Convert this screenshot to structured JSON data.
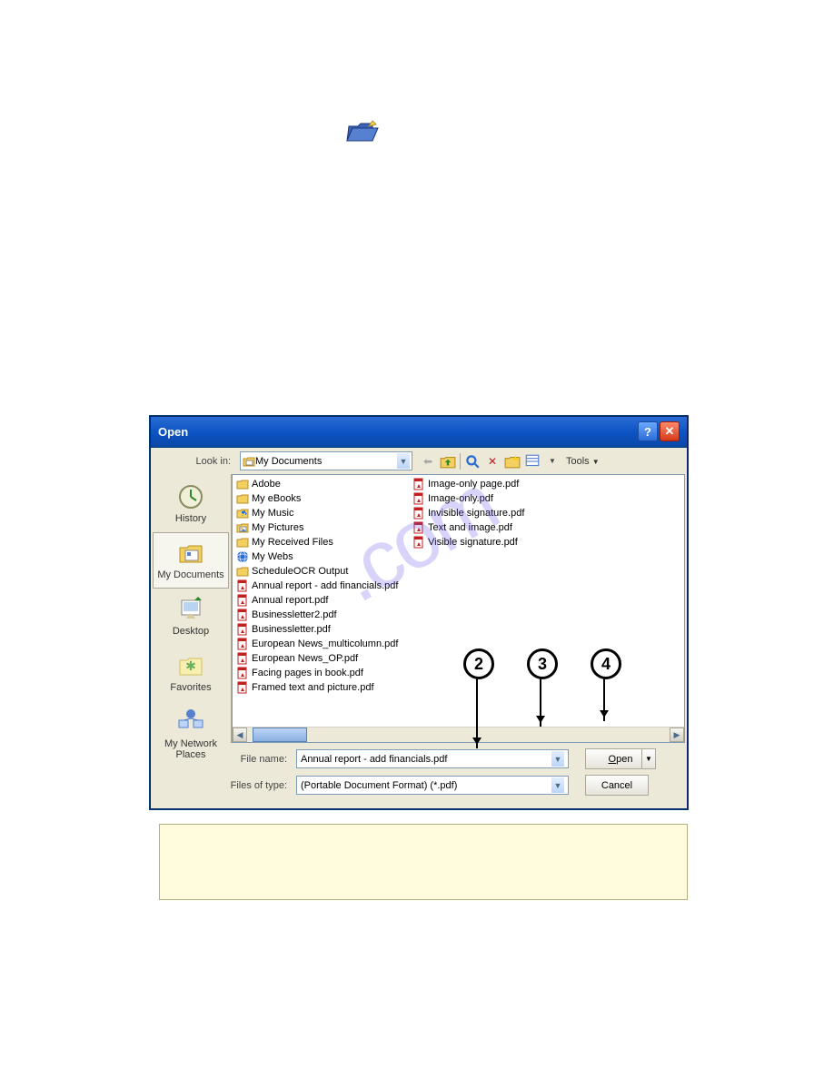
{
  "watermark_text": ".com",
  "dialog": {
    "title": "Open",
    "lookin_label": "Look in:",
    "lookin_value": "My Documents",
    "tools_label": "Tools",
    "places": [
      {
        "icon": "history",
        "label": "History"
      },
      {
        "icon": "mydocs",
        "label": "My Documents",
        "selected": true
      },
      {
        "icon": "desktop",
        "label": "Desktop"
      },
      {
        "icon": "favorites",
        "label": "Favorites"
      },
      {
        "icon": "network",
        "label": "My Network Places",
        "two_line": true
      }
    ],
    "files_col1": [
      {
        "icon": "folder",
        "name": "Adobe"
      },
      {
        "icon": "folder",
        "name": "My eBooks"
      },
      {
        "icon": "music",
        "name": "My Music"
      },
      {
        "icon": "pictures",
        "name": "My Pictures"
      },
      {
        "icon": "folder",
        "name": "My Received Files"
      },
      {
        "icon": "web",
        "name": "My Webs"
      },
      {
        "icon": "folder",
        "name": "ScheduleOCR Output"
      },
      {
        "icon": "pdf",
        "name": "Annual report - add financials.pdf"
      },
      {
        "icon": "pdf",
        "name": "Annual report.pdf"
      },
      {
        "icon": "pdf",
        "name": "Businessletter2.pdf"
      },
      {
        "icon": "pdf",
        "name": "Businessletter.pdf"
      },
      {
        "icon": "pdf",
        "name": "European News_multicolumn.pdf"
      },
      {
        "icon": "pdf",
        "name": "European News_OP.pdf"
      },
      {
        "icon": "pdf",
        "name": "Facing pages in book.pdf"
      },
      {
        "icon": "pdf",
        "name": "Framed text and picture.pdf"
      }
    ],
    "files_col2": [
      {
        "icon": "pdf",
        "name": "Image-only page.pdf"
      },
      {
        "icon": "pdf",
        "name": "Image-only.pdf"
      },
      {
        "icon": "pdf",
        "name": "Invisible signature.pdf"
      },
      {
        "icon": "pdf",
        "name": "Text and image.pdf"
      },
      {
        "icon": "pdf",
        "name": "Visible signature.pdf"
      }
    ],
    "filename_label": "File name:",
    "filename_value": "Annual report - add financials.pdf",
    "filetype_label": "Files of type:",
    "filetype_value": "(Portable Document Format) (*.pdf)",
    "open_btn": "Open",
    "cancel_btn": "Cancel"
  },
  "callouts": {
    "c2": "2",
    "c3": "3",
    "c4": "4"
  }
}
